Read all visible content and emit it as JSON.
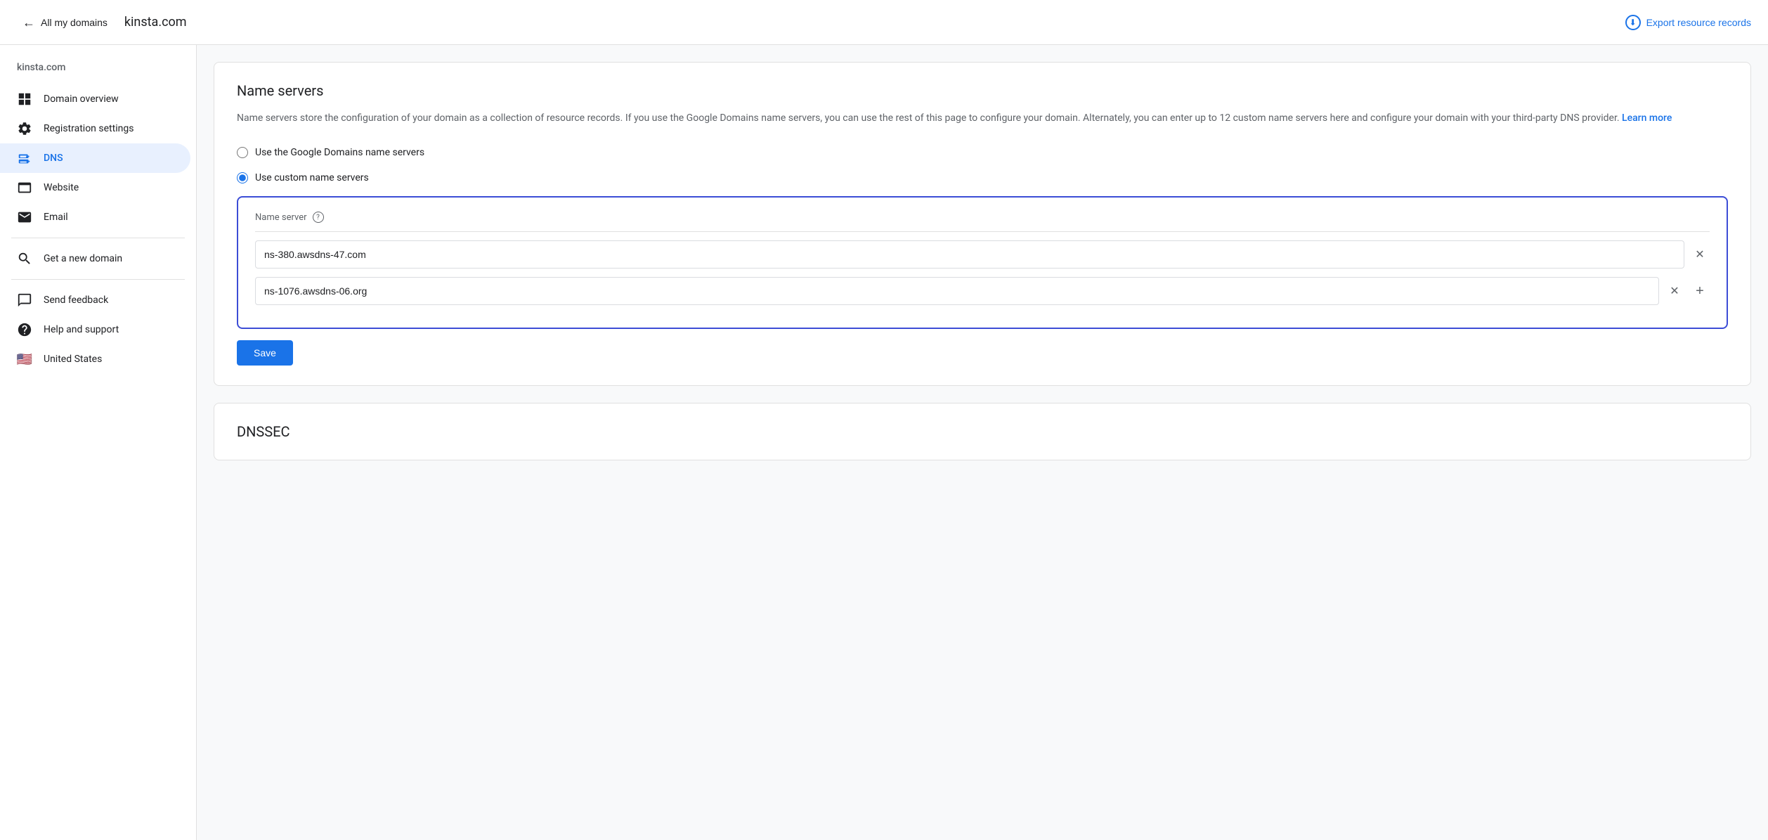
{
  "header": {
    "back_label": "All my domains",
    "domain": "kinsta.com",
    "export_label": "Export resource records"
  },
  "sidebar": {
    "domain": "kinsta.com",
    "items": [
      {
        "id": "domain-overview",
        "label": "Domain overview",
        "icon": "grid-icon",
        "active": false
      },
      {
        "id": "registration-settings",
        "label": "Registration settings",
        "icon": "settings-icon",
        "active": false
      },
      {
        "id": "dns",
        "label": "DNS",
        "icon": "dns-icon",
        "active": true
      },
      {
        "id": "website",
        "label": "Website",
        "icon": "website-icon",
        "active": false
      },
      {
        "id": "email",
        "label": "Email",
        "icon": "email-icon",
        "active": false
      }
    ],
    "bottom_items": [
      {
        "id": "get-new-domain",
        "label": "Get a new domain",
        "icon": "search-icon"
      },
      {
        "id": "send-feedback",
        "label": "Send feedback",
        "icon": "feedback-icon"
      },
      {
        "id": "help-support",
        "label": "Help and support",
        "icon": "help-icon"
      },
      {
        "id": "united-states",
        "label": "United States",
        "icon": "flag-icon"
      }
    ]
  },
  "name_servers": {
    "title": "Name servers",
    "description": "Name servers store the configuration of your domain as a collection of resource records. If you use the Google Domains name servers, you can use the rest of this page to configure your domain. Alternately, you can enter up to 12 custom name servers here and configure your domain with your third-party DNS provider.",
    "learn_more": "Learn more",
    "option_google": "Use the Google Domains name servers",
    "option_custom": "Use custom name servers",
    "ns_label": "Name server",
    "ns_values": [
      "ns-380.awsdns-47.com",
      "ns-1076.awsdns-06.org"
    ],
    "save_label": "Save"
  },
  "dnssec": {
    "title": "DNSSEC"
  }
}
